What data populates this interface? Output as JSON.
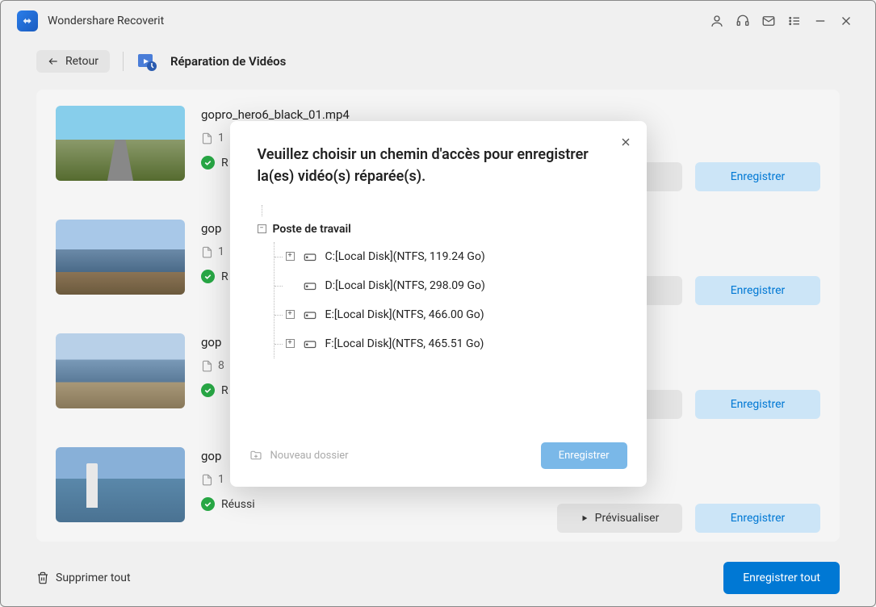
{
  "app_title": "Wondershare Recoverit",
  "subheader": {
    "back_label": "Retour",
    "page_title": "Réparation de Vidéos"
  },
  "videos": [
    {
      "name": "gopro_hero6_black_01.mp4",
      "size": "1",
      "status": "R"
    },
    {
      "name": "gop",
      "size": "1",
      "status": "R"
    },
    {
      "name": "gop",
      "size": "8",
      "status": "R"
    },
    {
      "name": "gop",
      "size": "1",
      "status": "Réussi"
    }
  ],
  "buttons": {
    "preview": "Prévisualiser",
    "save": "Enregistrer",
    "visualize_partial": "ualiser"
  },
  "footer": {
    "delete_all": "Supprimer tout",
    "save_all": "Enregistrer tout"
  },
  "modal": {
    "title": "Veuillez choisir un chemin d'accès pour enregistrer la(es) vidéo(s) réparée(s).",
    "root_label": "Poste de travail",
    "disks": [
      {
        "label": "C:[Local Disk](NTFS, 119.24 Go)",
        "expandable": true
      },
      {
        "label": "D:[Local Disk](NTFS, 298.09 Go)",
        "expandable": false
      },
      {
        "label": "E:[Local Disk](NTFS, 466.00 Go)",
        "expandable": true
      },
      {
        "label": "F:[Local Disk](NTFS, 465.51 Go)",
        "expandable": true
      }
    ],
    "new_folder": "Nouveau dossier",
    "save_label": "Enregistrer"
  }
}
